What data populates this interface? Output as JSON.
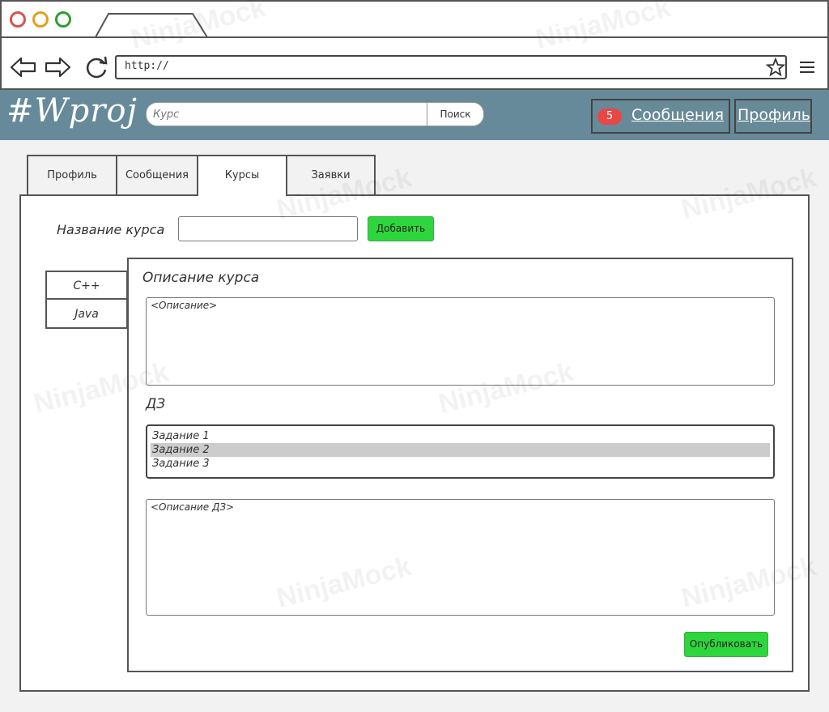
{
  "browser": {
    "url": "http://",
    "dot_colors": [
      "#d9534f",
      "#e0a020",
      "#2ca02c"
    ]
  },
  "header": {
    "logo": "#Wproj",
    "search_placeholder": "Курс",
    "search_button": "Поиск",
    "messages_count": "5",
    "messages_label": "Сообщения",
    "profile_label": "Профиль"
  },
  "tabs": [
    {
      "label": "Профиль"
    },
    {
      "label": "Сообщения"
    },
    {
      "label": "Курсы",
      "active": true
    },
    {
      "label": "Заявки"
    }
  ],
  "course_form": {
    "name_label": "Название курса",
    "add_button": "Добавить"
  },
  "courses": [
    {
      "name": "C++"
    },
    {
      "name": "Java"
    }
  ],
  "detail": {
    "title": "Описание курса",
    "description": "<Описание>",
    "homework_title": "ДЗ",
    "homework_items": [
      {
        "label": "Задание 1",
        "selected": false
      },
      {
        "label": "Задание 2",
        "selected": true
      },
      {
        "label": "Задание 3",
        "selected": false
      }
    ],
    "homework_description": "<Описание ДЗ>",
    "publish_button": "Опубликовать"
  },
  "watermark": "NinjaMock",
  "colors": {
    "header_bg": "#668a99",
    "green_button": "#2ed63e",
    "badge": "#e94646"
  }
}
